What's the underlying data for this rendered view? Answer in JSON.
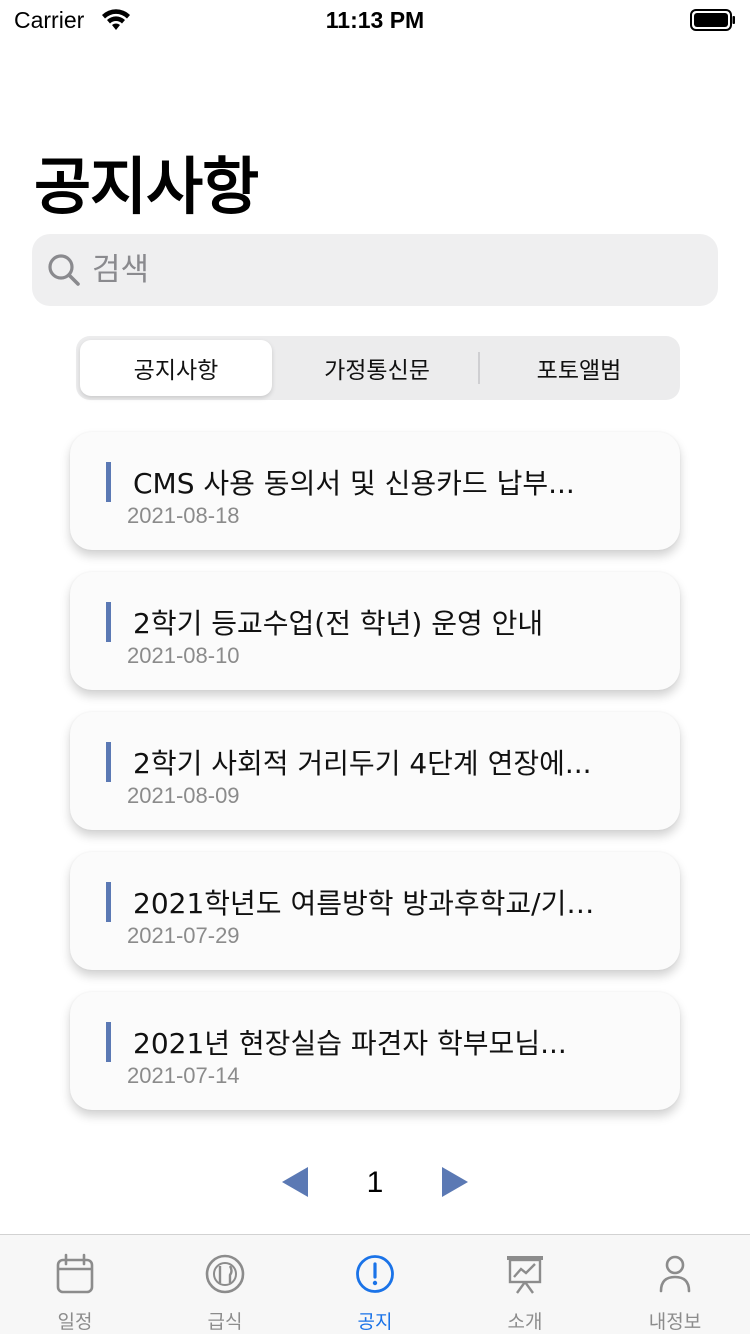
{
  "status_bar": {
    "carrier": "Carrier",
    "time": "11:13 PM"
  },
  "page": {
    "title": "공지사항"
  },
  "search": {
    "placeholder": "검색",
    "icon": "search-icon"
  },
  "segments": [
    {
      "label": "공지사항",
      "active": true
    },
    {
      "label": "가정통신문",
      "active": false
    },
    {
      "label": "포토앨범",
      "active": false
    }
  ],
  "notices": [
    {
      "title": "CMS 사용 동의서 및 신용카드 납부...",
      "date": "2021-08-18"
    },
    {
      "title": "2학기 등교수업(전 학년) 운영 안내",
      "date": "2021-08-10"
    },
    {
      "title": "2학기 사회적 거리두기 4단계 연장에...",
      "date": "2021-08-09"
    },
    {
      "title": "2021학년도 여름방학 방과후학교/기…",
      "date": "2021-07-29"
    },
    {
      "title": "2021년 현장실습 파견자 학부모님...",
      "date": "2021-07-14"
    }
  ],
  "pagination": {
    "current": "1"
  },
  "tabs": [
    {
      "label": "일정",
      "icon": "calendar-icon"
    },
    {
      "label": "급식",
      "icon": "meal-icon"
    },
    {
      "label": "공지",
      "icon": "notice-icon",
      "active": true
    },
    {
      "label": "소개",
      "icon": "presentation-icon"
    },
    {
      "label": "내정보",
      "icon": "person-icon"
    }
  ],
  "colors": {
    "accent": "#5b79b4",
    "active_tab": "#1a73e8",
    "pager_arrow": "#5b79b4"
  }
}
